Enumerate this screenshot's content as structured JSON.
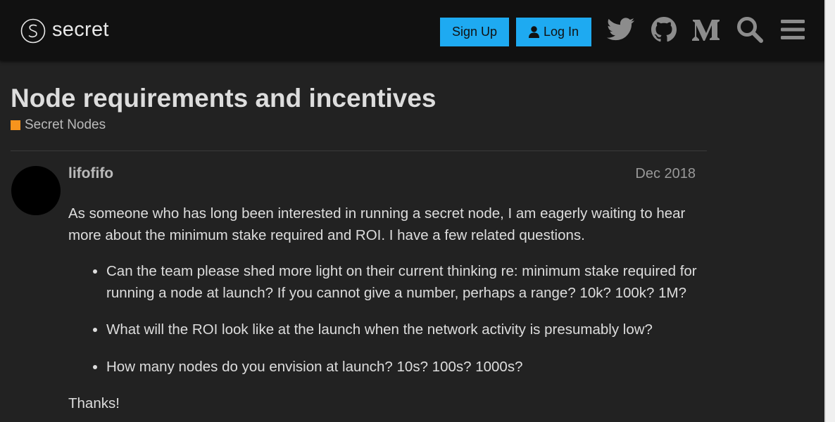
{
  "header": {
    "logo_text": "secret",
    "signup_label": "Sign Up",
    "login_label": "Log In",
    "icons": [
      "twitter-icon",
      "github-icon",
      "medium-icon",
      "search-icon",
      "menu-icon"
    ]
  },
  "topic": {
    "title": "Node requirements and incentives",
    "category": {
      "name": "Secret Nodes",
      "color": "#f7941d"
    }
  },
  "post": {
    "username": "lifofifo",
    "date": "Dec 2018",
    "intro": "As someone who has long been interested in running a secret node, I am eagerly waiting to hear more about the minimum stake required and ROI. I have a few related questions.",
    "questions": [
      "Can the team please shed more light on their current thinking re: minimum stake required for running a node at launch? If you cannot give a number, perhaps a range? 10k? 100k? 1M?",
      "What will the ROI look like at the launch when the network activity is presumably low?",
      "How many nodes do you envision at launch? 10s? 100s? 1000s?"
    ],
    "closing": "Thanks!"
  },
  "colors": {
    "accent": "#1eaaf1",
    "background": "#222222",
    "header": "#111111"
  }
}
